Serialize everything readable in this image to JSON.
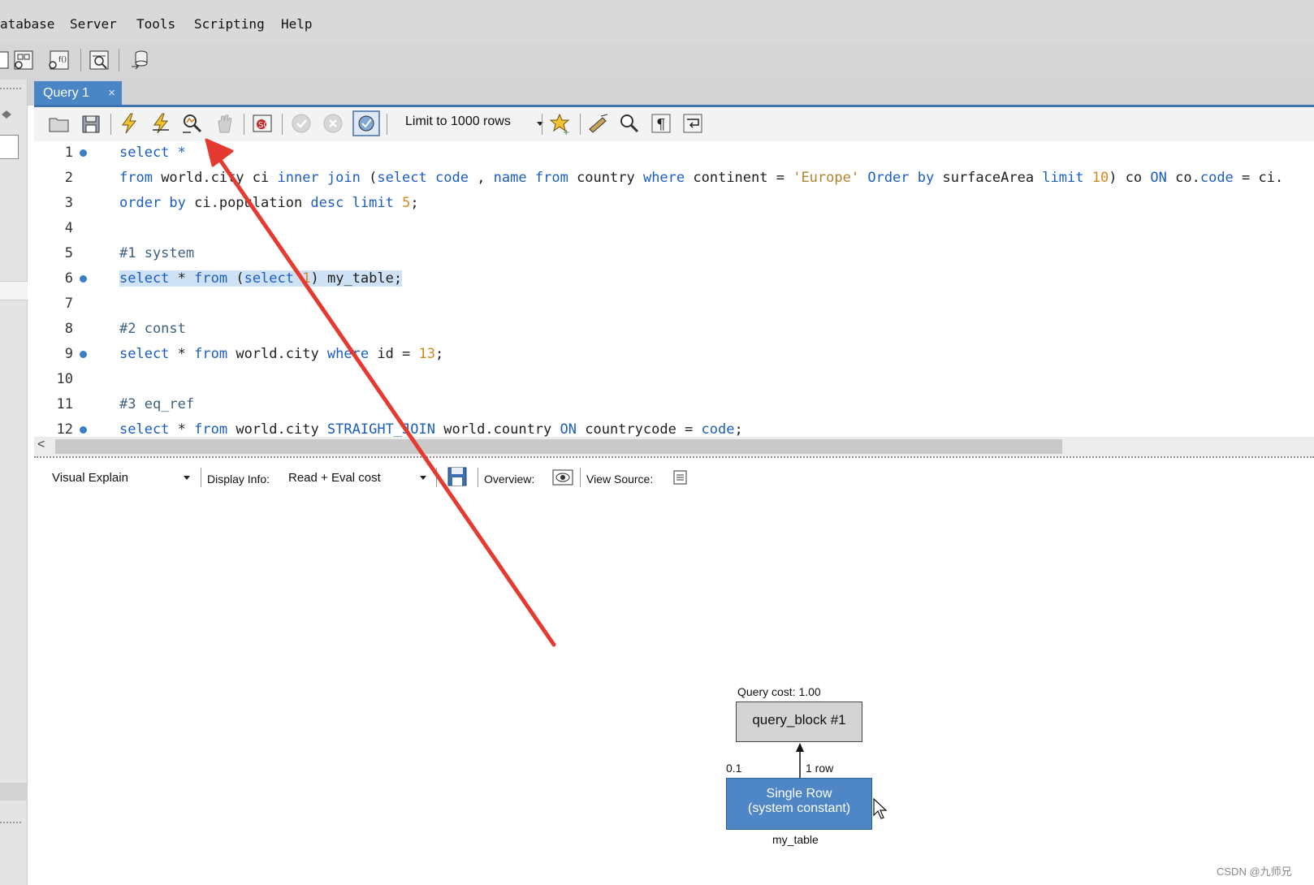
{
  "menu": {
    "items": [
      "atabase",
      "Server",
      "Tools",
      "Scripting",
      "Help"
    ]
  },
  "tab": {
    "label": "Query 1",
    "close": "×"
  },
  "sql_toolbar": {
    "limit_label": "Limit to 1000 rows"
  },
  "editor": {
    "lines": [
      {
        "n": "1"
      },
      {
        "n": "2"
      },
      {
        "n": "3"
      },
      {
        "n": "4"
      },
      {
        "n": "5"
      },
      {
        "n": "6"
      },
      {
        "n": "7"
      },
      {
        "n": "8"
      },
      {
        "n": "9"
      },
      {
        "n": "10"
      },
      {
        "n": "11"
      },
      {
        "n": "12"
      }
    ],
    "code": {
      "l1": "select *",
      "l2": [
        "from",
        " world.city ci ",
        "inner join",
        " (",
        "select",
        " ",
        "code",
        " , ",
        "name",
        " ",
        "from",
        " country ",
        "where",
        " continent = ",
        "'Europe'",
        " ",
        "Order by",
        " surfaceArea ",
        "limit",
        " ",
        "10",
        ") co ",
        "ON",
        " co.",
        "code",
        " = ci."
      ],
      "l3": [
        "order by",
        " ci.population ",
        "desc",
        " ",
        "limit",
        " ",
        "5",
        ";"
      ],
      "l5": "#1 system",
      "l6": [
        "select",
        " * ",
        "from",
        " (",
        "select",
        " ",
        "1",
        ") my_table;"
      ],
      "l8": "#2 const",
      "l9": [
        "select",
        " * ",
        "from",
        " world.city ",
        "where",
        " id = ",
        "13",
        ";"
      ],
      "l11": "#3 eq_ref",
      "l12": [
        "select",
        " * ",
        "from",
        " world.city ",
        "STRAIGHT_JOIN",
        " world.country ",
        "ON",
        " countrycode = ",
        "code",
        ";"
      ]
    }
  },
  "explain_bar": {
    "mode": "Visual Explain",
    "display_info_label": "Display Info:",
    "display_info_value": "Read + Eval cost",
    "overview_label": "Overview:",
    "view_source_label": "View Source:"
  },
  "diagram": {
    "query_cost": "Query cost: 1.00",
    "query_block": "query_block #1",
    "cost_left": "0.1",
    "rows": "1 row",
    "access_type_line1": "Single Row",
    "access_type_line2": "(system constant)",
    "table_name": "my_table"
  },
  "watermark": "CSDN @九师兄",
  "colors": {
    "accent": "#4a86c5",
    "keyword": "#1b5dc1",
    "string": "#b1822d",
    "number": "#d4881c",
    "annotation_arrow": "#e53a2f",
    "single_row_box": "#4f86c6"
  }
}
